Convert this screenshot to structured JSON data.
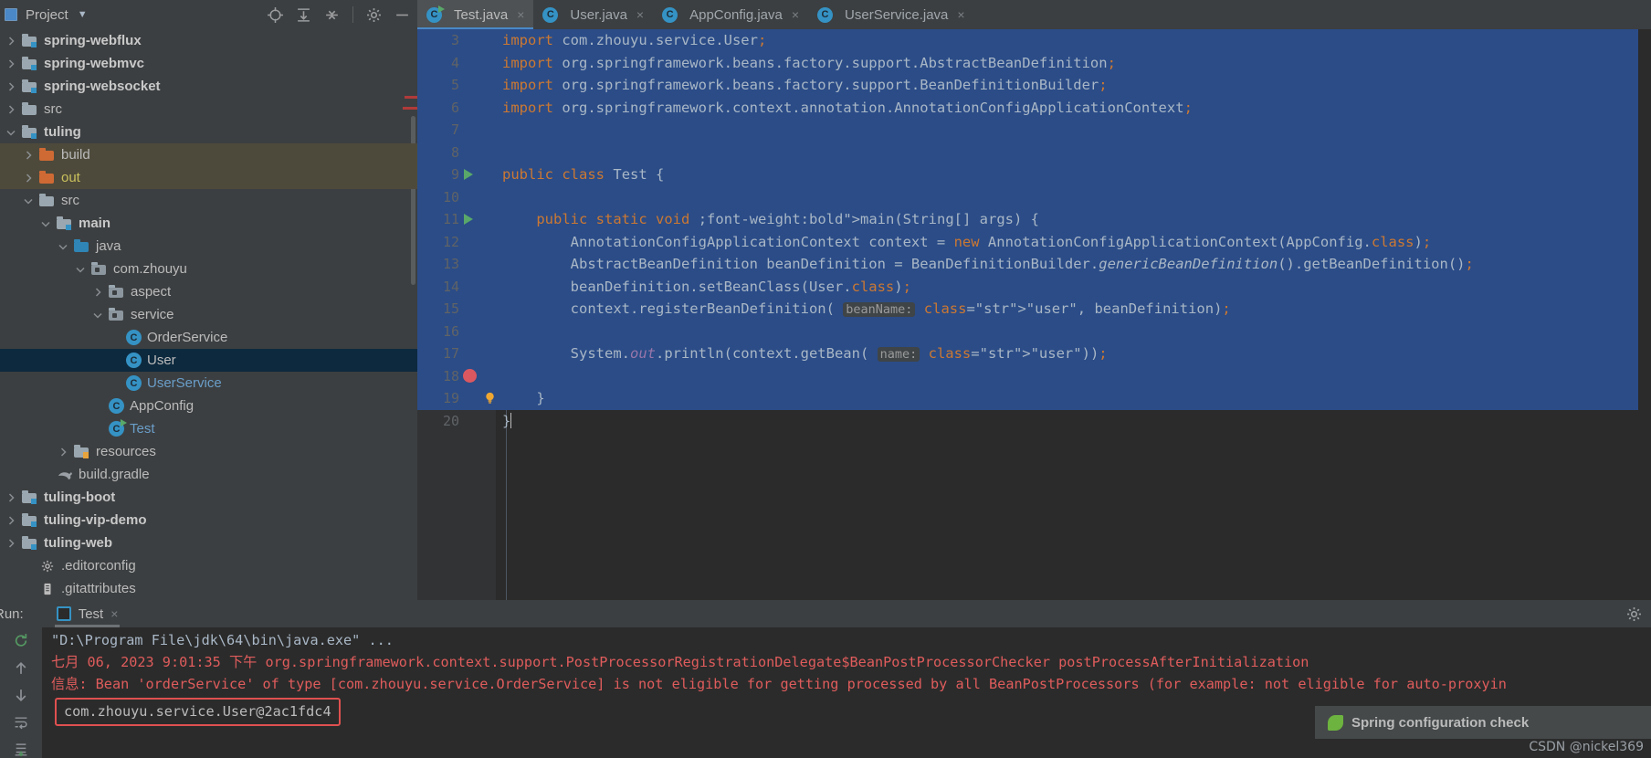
{
  "project_panel": {
    "title": "Project",
    "caret": "▼",
    "icons": [
      "locate-icon",
      "expand-all-icon",
      "collapse-all-icon",
      "gear-icon",
      "minimize-icon"
    ],
    "tree": [
      {
        "label": "spring-webflux",
        "indent": 0,
        "arrow": "right",
        "icon": "module-folder",
        "style": "bold"
      },
      {
        "label": "spring-webmvc",
        "indent": 0,
        "arrow": "right",
        "icon": "module-folder",
        "style": "bold"
      },
      {
        "label": "spring-websocket",
        "indent": 0,
        "arrow": "right",
        "icon": "module-folder",
        "style": "bold"
      },
      {
        "label": "src",
        "indent": 0,
        "arrow": "right",
        "icon": "folder",
        "style": "normal"
      },
      {
        "label": "tuling",
        "indent": 0,
        "arrow": "down",
        "icon": "module-folder",
        "style": "bold"
      },
      {
        "label": "build",
        "indent": 1,
        "arrow": "right",
        "icon": "folder-orange",
        "style": "normal",
        "row": "highlight"
      },
      {
        "label": "out",
        "indent": 1,
        "arrow": "right",
        "icon": "folder-orange",
        "style": "yellow",
        "row": "highlight"
      },
      {
        "label": "src",
        "indent": 1,
        "arrow": "down",
        "icon": "folder",
        "style": "normal"
      },
      {
        "label": "main",
        "indent": 2,
        "arrow": "down",
        "icon": "module-folder",
        "style": "bold"
      },
      {
        "label": "java",
        "indent": 3,
        "arrow": "down",
        "icon": "folder-blue",
        "style": "normal"
      },
      {
        "label": "com.zhouyu",
        "indent": 4,
        "arrow": "down",
        "icon": "package",
        "style": "normal"
      },
      {
        "label": "aspect",
        "indent": 5,
        "arrow": "right",
        "icon": "package",
        "style": "normal"
      },
      {
        "label": "service",
        "indent": 5,
        "arrow": "down",
        "icon": "package",
        "style": "normal"
      },
      {
        "label": "OrderService",
        "indent": 6,
        "arrow": "none",
        "icon": "class",
        "style": "normal"
      },
      {
        "label": "User",
        "indent": 6,
        "arrow": "none",
        "icon": "class",
        "style": "normal",
        "row": "selected"
      },
      {
        "label": "UserService",
        "indent": 6,
        "arrow": "none",
        "icon": "class",
        "style": "blue"
      },
      {
        "label": "AppConfig",
        "indent": 5,
        "arrow": "none",
        "icon": "class",
        "style": "normal"
      },
      {
        "label": "Test",
        "indent": 5,
        "arrow": "none",
        "icon": "class-runnable",
        "style": "blue"
      },
      {
        "label": "resources",
        "indent": 3,
        "arrow": "right",
        "icon": "folder-resources",
        "style": "normal"
      },
      {
        "label": "build.gradle",
        "indent": 2,
        "arrow": "none",
        "icon": "gradle",
        "style": "normal"
      },
      {
        "label": "tuling-boot",
        "indent": 0,
        "arrow": "right",
        "icon": "module-folder",
        "style": "bold"
      },
      {
        "label": "tuling-vip-demo",
        "indent": 0,
        "arrow": "right",
        "icon": "module-folder",
        "style": "bold"
      },
      {
        "label": "tuling-web",
        "indent": 0,
        "arrow": "right",
        "icon": "module-folder",
        "style": "bold"
      },
      {
        "label": ".editorconfig",
        "indent": 1,
        "arrow": "none",
        "icon": "gear-file",
        "style": "normal"
      },
      {
        "label": ".gitattributes",
        "indent": 1,
        "arrow": "none",
        "icon": "text-file",
        "style": "normal"
      }
    ]
  },
  "editor_tabs": [
    {
      "label": "Test.java",
      "active": true,
      "icon": "class-runnable-icon",
      "close": "×"
    },
    {
      "label": "User.java",
      "active": false,
      "icon": "class-icon",
      "close": "×"
    },
    {
      "label": "AppConfig.java",
      "active": false,
      "icon": "class-icon",
      "close": "×"
    },
    {
      "label": "UserService.java",
      "active": false,
      "icon": "class-icon",
      "close": "×"
    }
  ],
  "code": {
    "lines": [
      {
        "n": "3",
        "text": "import com.zhouyu.service.User;",
        "clipped_top": true
      },
      {
        "n": "4",
        "text": "import org.springframework.beans.factory.support.AbstractBeanDefinition;"
      },
      {
        "n": "5",
        "text": "import org.springframework.beans.factory.support.BeanDefinitionBuilder;"
      },
      {
        "n": "6",
        "text": "import org.springframework.context.annotation.AnnotationConfigApplicationContext;"
      },
      {
        "n": "7",
        "text": ""
      },
      {
        "n": "8",
        "text": ""
      },
      {
        "n": "9",
        "text": "public class Test {"
      },
      {
        "n": "10",
        "text": ""
      },
      {
        "n": "11",
        "text": "    public static void main(String[] args) {"
      },
      {
        "n": "12",
        "text": "        AnnotationConfigApplicationContext context = new AnnotationConfigApplicationContext(AppConfig.class);"
      },
      {
        "n": "13",
        "text": "        AbstractBeanDefinition beanDefinition = BeanDefinitionBuilder.genericBeanDefinition().getBeanDefinition();"
      },
      {
        "n": "14",
        "text": "        beanDefinition.setBeanClass(User.class);"
      },
      {
        "n": "15",
        "text": "        context.registerBeanDefinition( beanName: \"user\", beanDefinition);"
      },
      {
        "n": "16",
        "text": ""
      },
      {
        "n": "17",
        "text": "        System.out.println(context.getBean( name: \"user\"));"
      },
      {
        "n": "18",
        "text": "",
        "breakpoint": true
      },
      {
        "n": "19",
        "text": "    }",
        "bulb": true
      },
      {
        "n": "20",
        "text": "}",
        "caret": true
      }
    ],
    "param_hints": [
      "beanName:",
      "name:"
    ],
    "string_literals": [
      "\"user\""
    ]
  },
  "run_panel": {
    "label": "Run:",
    "tab_label": "Test",
    "tab_close": "×",
    "settings_icon": "gear-icon",
    "toolbar_icons": [
      "rerun-icon",
      "up-arrow-icon",
      "down-arrow-icon",
      "soft-wrap-icon",
      "scroll-end-icon"
    ],
    "console": [
      {
        "text": "\"D:\\Program File\\jdk\\64\\bin\\java.exe\" ...",
        "color": "gray"
      },
      {
        "text": "七月 06, 2023 9:01:35 下午 org.springframework.context.support.PostProcessorRegistrationDelegate$BeanPostProcessorChecker postProcessAfterInitialization",
        "color": "red"
      },
      {
        "text": "信息: Bean 'orderService' of type [com.zhouyu.service.OrderService] is not eligible for getting processed by all BeanPostProcessors (for example: not eligible for auto-proxyin",
        "color": "red"
      }
    ],
    "output_value": "com.zhouyu.service.User@2ac1fdc4"
  },
  "notification": {
    "text": "Spring configuration check",
    "icon": "spring-leaf-icon"
  },
  "watermark": "CSDN @nickel369",
  "colors": {
    "accent": "#3592c4",
    "selection": "#2b4c87",
    "tree_selection": "#0d293e",
    "error_red": "#e05c5c",
    "keyword_orange": "#cc7832",
    "string_green": "#6a8759",
    "editor_bg": "#2b2b2b",
    "panel_bg": "#3c3f41"
  }
}
